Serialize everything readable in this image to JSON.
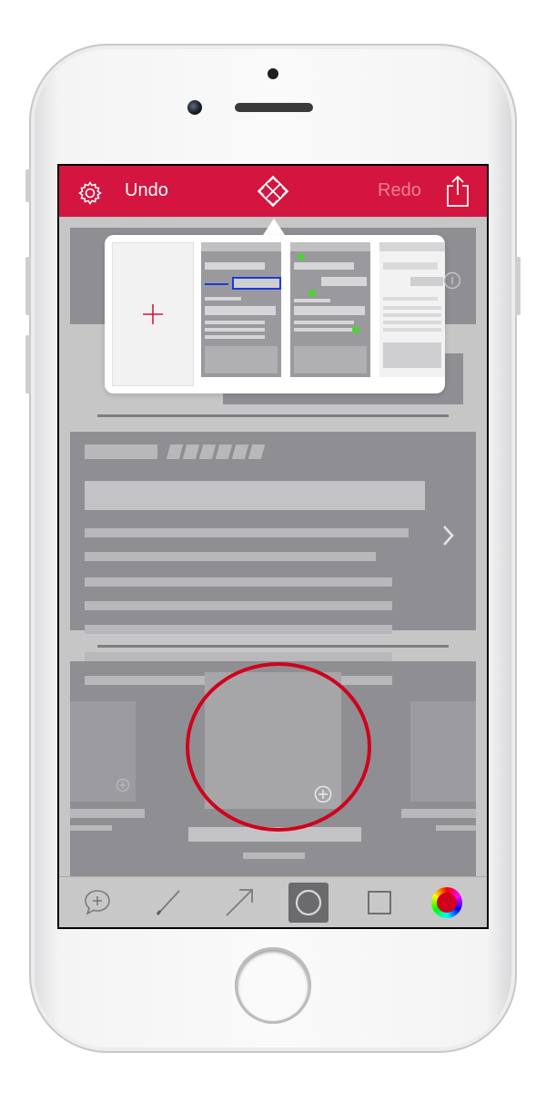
{
  "toolbar": {
    "undo_label": "Undo",
    "redo_label": "Redo",
    "settings_icon": "gear-icon",
    "logo_icon": "crosshair-logo-icon",
    "share_icon": "share-icon"
  },
  "popover": {
    "add_icon": "plus-icon",
    "thumbnails": [
      "thumbnail-1",
      "thumbnail-2",
      "thumbnail-3"
    ]
  },
  "tools": [
    {
      "name": "comment-tool",
      "icon": "comment-plus-icon"
    },
    {
      "name": "pen-tool",
      "icon": "pen-icon"
    },
    {
      "name": "arrow-tool",
      "icon": "arrow-icon"
    },
    {
      "name": "ellipse-tool",
      "icon": "circle-icon",
      "selected": true
    },
    {
      "name": "rectangle-tool",
      "icon": "square-icon"
    },
    {
      "name": "color-tool",
      "icon": "color-wheel-icon"
    }
  ],
  "colors": {
    "accent": "#d4153f",
    "redo_disabled": "#eb7f93",
    "annotation_circle": "#d0021b"
  },
  "annotation": {
    "shape": "ellipse"
  }
}
